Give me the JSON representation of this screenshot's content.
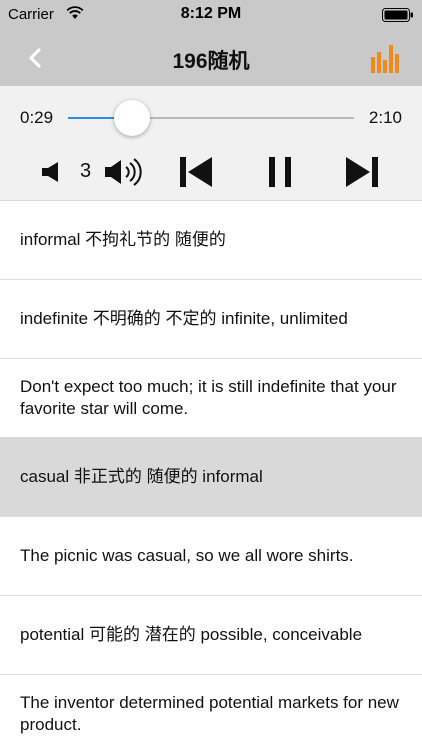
{
  "status_bar": {
    "carrier": "Carrier",
    "time": "8:12 PM"
  },
  "nav": {
    "title": "196随机"
  },
  "player": {
    "time_current": "0:29",
    "time_total": "2:10",
    "progress_fraction": 0.223,
    "volume_level": "3",
    "accent_color": "#2a8ee6"
  },
  "list": {
    "selected_index": 3,
    "items": [
      {
        "text": "informal 不拘礼节的 随便的"
      },
      {
        "text": "indefinite 不明确的 不定的 infinite,  unlimited"
      },
      {
        "text": "Don't expect too much; it is still  indefinite that your favorite star will  come."
      },
      {
        "text": "casual 非正式的 随便的 informal"
      },
      {
        "text": "The picnic was casual, so we all wore  shirts."
      },
      {
        "text": "potential 可能的 潜在的 possible, conceivable"
      },
      {
        "text": "The inventor determined potential markets for new product."
      }
    ]
  },
  "icons": {
    "back": "chevron-left-icon",
    "equalizer": "equalizer-icon",
    "volume_down": "speaker-icon",
    "volume_up": "speaker-waves-icon",
    "previous": "skip-previous-icon",
    "pause": "pause-icon",
    "next": "skip-next-icon"
  },
  "colors": {
    "eq_orange": "#f08a1c",
    "bar_gray": "#c9c9c9",
    "selected_row": "#d9d9d9"
  }
}
